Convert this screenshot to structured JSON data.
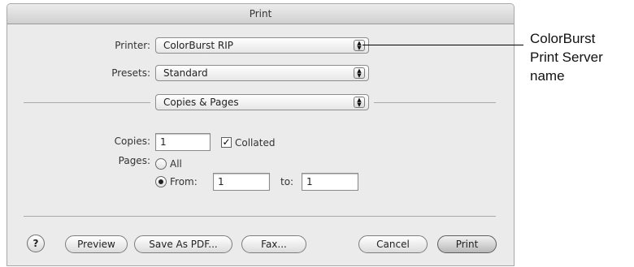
{
  "window": {
    "title": "Print"
  },
  "printer": {
    "label": "Printer:",
    "value": "ColorBurst RIP"
  },
  "presets": {
    "label": "Presets:",
    "value": "Standard"
  },
  "panel": {
    "value": "Copies & Pages"
  },
  "copies": {
    "label": "Copies:",
    "value": "1",
    "collated_label": "Collated",
    "collated_checked": true
  },
  "pages": {
    "label": "Pages:",
    "all_label": "All",
    "from_label": "From:",
    "from_value": "1",
    "to_label": "to:",
    "to_value": "1",
    "selected": "from"
  },
  "buttons": {
    "help": "?",
    "preview": "Preview",
    "save_pdf": "Save As PDF...",
    "fax": "Fax...",
    "cancel": "Cancel",
    "print": "Print"
  },
  "callout": {
    "lines": [
      "ColorBurst",
      "Print Server",
      "name"
    ]
  }
}
